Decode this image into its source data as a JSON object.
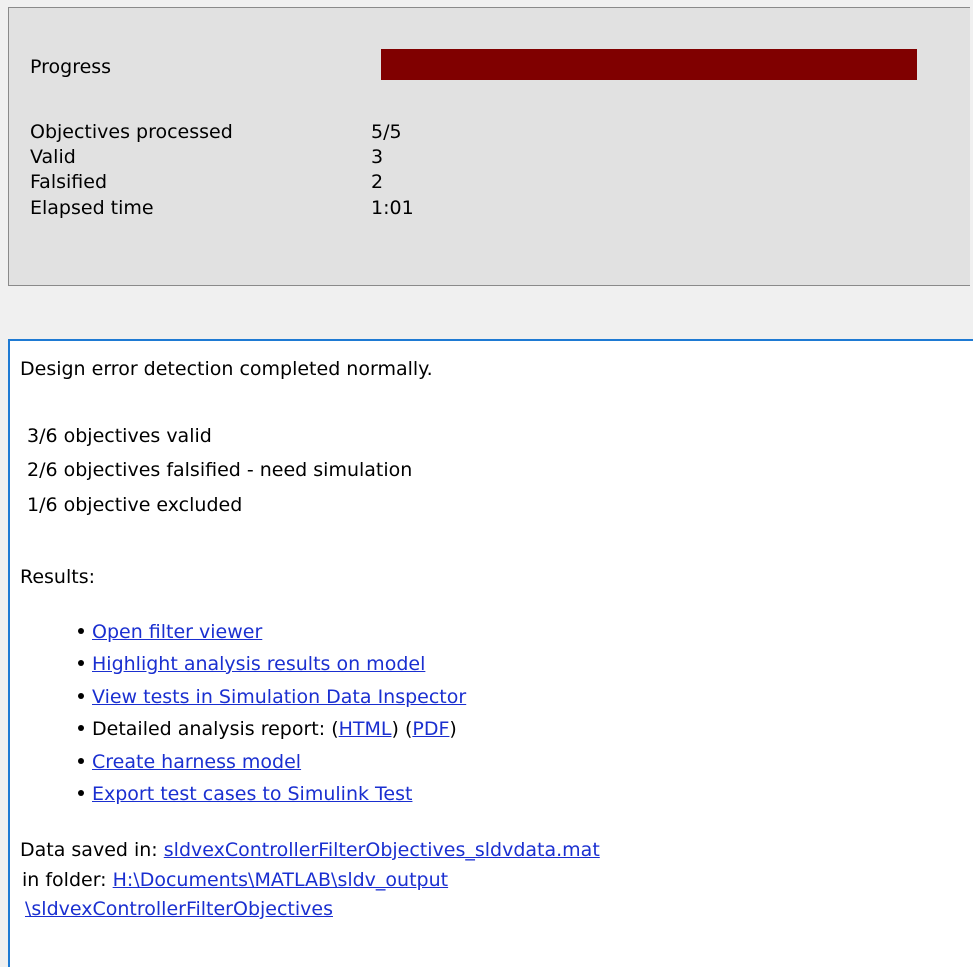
{
  "status": {
    "progress_label": "Progress",
    "progress_fraction": 1.0,
    "progress_color": "#800000",
    "rows": [
      {
        "label": "Objectives processed",
        "value": "5/5"
      },
      {
        "label": "Valid",
        "value": "3"
      },
      {
        "label": "Falsified",
        "value": "2"
      },
      {
        "label": "Elapsed time",
        "value": "1:01"
      }
    ]
  },
  "results": {
    "headline": "Design error detection completed normally.",
    "summary": [
      "3/6 objectives valid",
      "2/6 objectives falsified - need simulation",
      "1/6 objective excluded"
    ],
    "results_label": "Results:",
    "links": {
      "open_filter_viewer": "Open filter viewer",
      "highlight_results": "Highlight analysis results on model",
      "view_tests_sdi": "View tests in Simulation Data Inspector",
      "report_prefix": "Detailed analysis report: (",
      "report_html": "HTML",
      "report_mid": ") (",
      "report_pdf": "PDF",
      "report_suffix": ")",
      "create_harness": "Create harness model",
      "export_test_cases": "Export test cases to Simulink Test"
    },
    "data_saved_label": "Data saved in:",
    "data_file": "sldvexControllerFilterObjectives_sldvdata.mat",
    "in_folder_label": "in folder:",
    "folder_path_1": "H:\\Documents\\MATLAB\\sldv_output",
    "folder_path_2": "\\sldvexControllerFilterObjectives"
  }
}
